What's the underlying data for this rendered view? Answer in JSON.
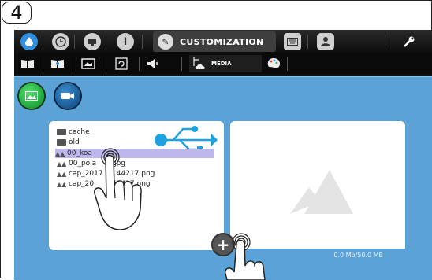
{
  "step_number": "4",
  "toolbar": {
    "tabs": [
      {
        "name": "water-drop-icon"
      },
      {
        "name": "clock-icon"
      },
      {
        "name": "screen-icon"
      },
      {
        "name": "info-icon"
      },
      {
        "name": "pen-icon",
        "label": "CUSTOMIZATION"
      },
      {
        "name": "keyboard-icon"
      },
      {
        "name": "users-icon"
      },
      {
        "name": "wrench-icon"
      }
    ]
  },
  "subbar": {
    "items": [
      {
        "name": "book-icon"
      },
      {
        "name": "open-book-icon"
      },
      {
        "name": "picture-frame-icon"
      },
      {
        "name": "rotate-icon"
      },
      {
        "name": "speaker-icon"
      },
      {
        "name": "media-icon",
        "label": "MEDIA"
      },
      {
        "name": "palette-icon"
      }
    ]
  },
  "media": {
    "mode_buttons": [
      "image-icon",
      "video-camera-icon"
    ],
    "files": [
      {
        "type": "folder",
        "name": "cache"
      },
      {
        "type": "folder",
        "name": "old"
      },
      {
        "type": "image",
        "name": "00_koa",
        "selected": true
      },
      {
        "type": "image",
        "name": "00_pola       .jpg"
      },
      {
        "type": "image",
        "name": "cap_2017      44217.png"
      },
      {
        "type": "image",
        "name": "cap_20        44427.png"
      }
    ],
    "storage": "0.0 Mb/50.0 MB",
    "add_label": "+"
  },
  "colors": {
    "content_bg": "#5ba2d6",
    "selected_row": "#bcb8ec",
    "images_button": "#1ab53a",
    "videos_button": "#1d66b0",
    "usb_accent": "#1fa0e0"
  }
}
